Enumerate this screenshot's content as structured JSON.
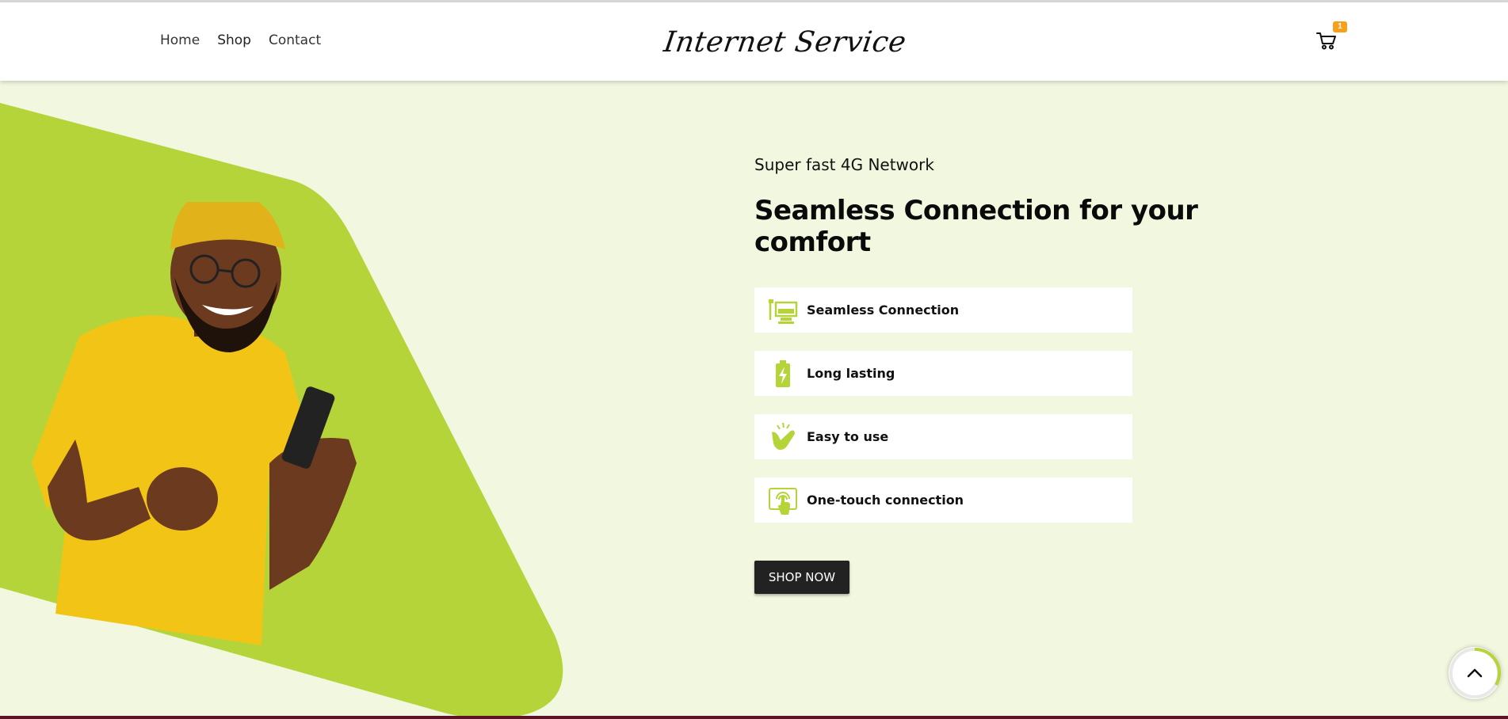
{
  "header": {
    "nav": [
      "Home",
      "Shop",
      "Contact"
    ],
    "logo_text": "Internet Service",
    "cart_count": "1"
  },
  "hero": {
    "tagline": "Super fast 4G Network",
    "headline": "Seamless Connection for your comfort",
    "features": [
      {
        "icon": "computer-network-icon",
        "label": "Seamless Connection"
      },
      {
        "icon": "battery-charge-icon",
        "label": "Long lasting"
      },
      {
        "icon": "snap-fingers-icon",
        "label": "Easy to use"
      },
      {
        "icon": "touch-screen-icon",
        "label": "One-touch connection"
      }
    ],
    "cta_label": "SHOP NOW"
  },
  "colors": {
    "accent_green": "#b5d43a",
    "page_bg": "#f2f7e0",
    "badge_orange": "#f7a01c",
    "button_dark": "#222222"
  }
}
